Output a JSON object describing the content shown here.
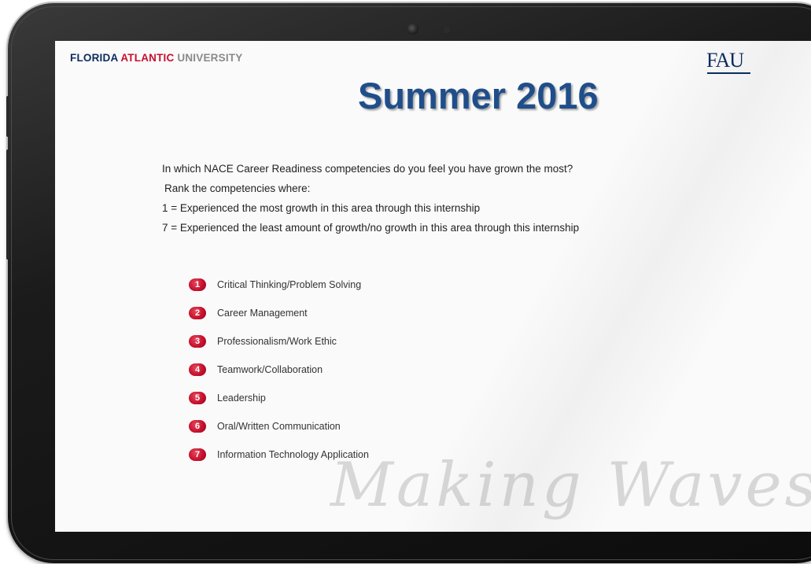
{
  "header": {
    "brand_word1": "FLORIDA",
    "brand_word2": "ATLANTIC",
    "brand_word3": "UNIVERSITY",
    "logo": "FAU"
  },
  "slide": {
    "title": "Summer 2016",
    "prompt_lines": [
      "In which NACE Career Readiness competencies do you feel you have grown the most?",
      "Rank the competencies where:",
      "1 = Experienced the most growth in this area through this internship",
      "7 = Experienced the least amount of growth/no growth in this area through this internship"
    ],
    "competencies": [
      {
        "rank": "1",
        "label": "Critical Thinking/Problem Solving"
      },
      {
        "rank": "2",
        "label": "Career Management"
      },
      {
        "rank": "3",
        "label": "Professionalism/Work Ethic"
      },
      {
        "rank": "4",
        "label": "Teamwork/Collaboration"
      },
      {
        "rank": "5",
        "label": "Leadership"
      },
      {
        "rank": "6",
        "label": "Oral/Written Communication"
      },
      {
        "rank": "7",
        "label": "Information Technology Application"
      }
    ],
    "watermark": "Making Waves"
  },
  "colors": {
    "brand_navy": "#0b2c5e",
    "brand_red": "#c8102e",
    "title_blue": "#1f4e8a"
  },
  "icons": [
    "camera-icon",
    "sensor-icon"
  ]
}
